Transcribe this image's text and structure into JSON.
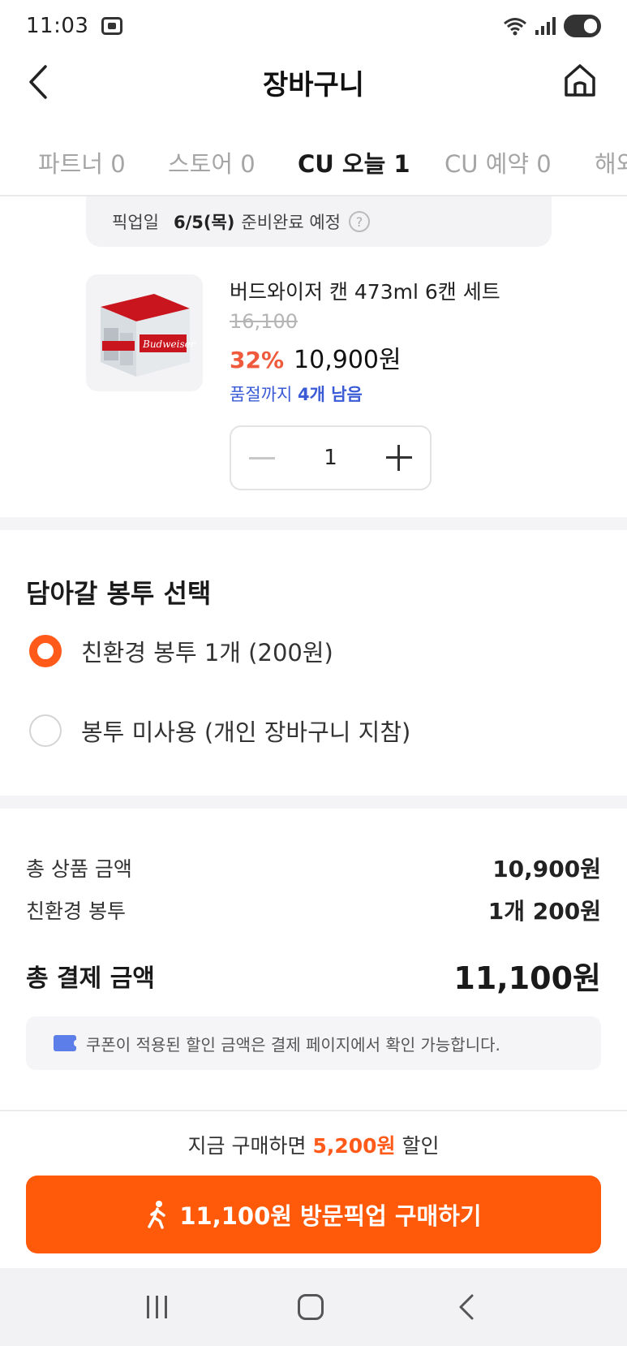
{
  "status_bar": {
    "time": "11:03"
  },
  "header": {
    "title": "장바구니"
  },
  "tabs": [
    {
      "label": "파트너 0"
    },
    {
      "label": "스토어 0"
    },
    {
      "label": "CU 오늘 1"
    },
    {
      "label": "CU 예약 0"
    },
    {
      "label": "해외"
    }
  ],
  "pickup": {
    "label": "픽업일",
    "date": "6/5(목)",
    "status": "준비완료 예정",
    "help": "?"
  },
  "product": {
    "name": "버드와이저 캔 473ml 6캔 세트",
    "original_price": "16,100",
    "discount": "32%",
    "price": "10,900원",
    "stock_prefix": "품절까지 ",
    "stock_count": "4개 남음",
    "quantity": "1"
  },
  "bag": {
    "title": "담아갈 봉투 선택",
    "options": [
      {
        "label": "친환경 봉투 1개 (200원)",
        "selected": true
      },
      {
        "label": "봉투 미사용 (개인 장바구니 지참)",
        "selected": false
      }
    ]
  },
  "summary": {
    "product_total_label": "총 상품 금액",
    "product_total_value": "10,900원",
    "bag_label": "친환경 봉투",
    "bag_value": "1개 200원",
    "grand_total_label": "총 결제 금액",
    "grand_total_value": "11,100원"
  },
  "coupon_note": "쿠폰이 적용된 할인 금액은 결제 페이지에서 확인 가능합니다.",
  "savings": {
    "prefix": "지금 구매하면 ",
    "amount": "5,200원",
    "suffix": " 할인"
  },
  "buy_button": {
    "label": "11,100원 방문픽업 구매하기"
  },
  "colors": {
    "accent": "#ff5a0a",
    "discount": "#f05a3c",
    "stock": "#3b5bd6"
  }
}
